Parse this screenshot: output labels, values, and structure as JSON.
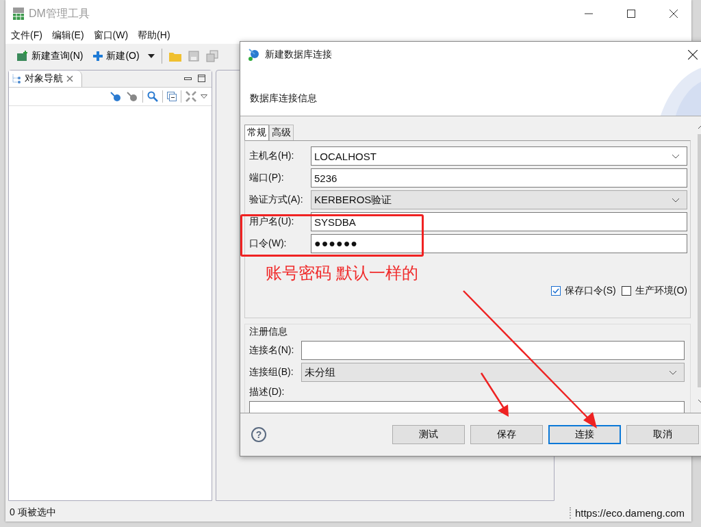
{
  "app_window": {
    "title": "DM管理工具",
    "menu": [
      "文件(F)",
      "编辑(E)",
      "窗口(W)",
      "帮助(H)"
    ],
    "toolbar": [
      {
        "kind": "query",
        "label": "新建查询(N)"
      },
      {
        "kind": "new",
        "label": "新建(O)"
      }
    ],
    "navigator": {
      "title": "对象导航"
    },
    "status_bar": {
      "selection": "0 项被选中",
      "link": "https://eco.dameng.com"
    }
  },
  "dialog": {
    "title": "新建数据库连接",
    "header": "数据库连接信息",
    "tabs": [
      {
        "label": "常规",
        "selected": true
      },
      {
        "label": "高级",
        "selected": false
      }
    ],
    "fields": [
      {
        "label": "主机名(H):",
        "kind": "combo",
        "value": "LOCALHOST"
      },
      {
        "label": "端口(P):",
        "kind": "text",
        "value": "5236"
      },
      {
        "label": "验证方式(A):",
        "kind": "select",
        "value": "KERBEROS验证"
      },
      {
        "label": "用户名(U):",
        "kind": "text",
        "value": "SYSDBA"
      },
      {
        "label": "口令(W):",
        "kind": "password",
        "value": "●●●●●●"
      }
    ],
    "options": [
      {
        "label": "保存口令(S)",
        "checked": true
      },
      {
        "label": "生产环境(O)",
        "checked": false
      }
    ],
    "registration": {
      "title": "注册信息",
      "fields": [
        {
          "label": "连接名(N):",
          "kind": "text"
        },
        {
          "label": "连接组(B):",
          "kind": "select",
          "value": "未分组"
        },
        {
          "label": "描述(D):",
          "kind": "textarea"
        }
      ]
    },
    "help": "?",
    "buttons": [
      {
        "label": "测试",
        "default": false
      },
      {
        "label": "保存",
        "default": false
      },
      {
        "label": "连接",
        "default": true
      },
      {
        "label": "取消",
        "default": false
      }
    ]
  },
  "annotation": {
    "text": "账号密码 默认一样的"
  }
}
